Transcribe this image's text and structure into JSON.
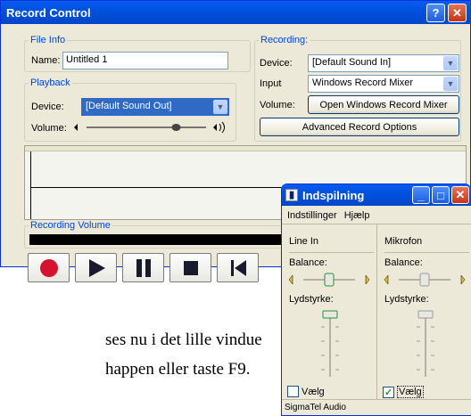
{
  "record_control": {
    "title": "Record Control",
    "file_info": {
      "legend": "File Info",
      "name_label": "Name:",
      "name_value": "Untitled 1"
    },
    "playback": {
      "legend": "Playback",
      "device_label": "Device:",
      "device_value": "[Default Sound Out]",
      "volume_label": "Volume:",
      "volume_level": 0.75
    },
    "recording": {
      "legend": "Recording:",
      "device_label": "Device:",
      "device_value": "[Default Sound In]",
      "input_label": "Input",
      "input_value": "Windows Record Mixer",
      "volume_label": "Volume:",
      "open_mixer_label": "Open Windows Record Mixer",
      "advanced_label": "Advanced Record Options"
    },
    "recording_volume_label": "Recording Volume",
    "transport": [
      "record",
      "play",
      "pause",
      "stop",
      "previous"
    ]
  },
  "mixer": {
    "title": "Indspilning",
    "menu": [
      "Indstillinger",
      "Hjælp"
    ],
    "channels": [
      {
        "name": "Line In",
        "balance_label": "Balance:",
        "volume_label": "Lydstyrke:",
        "select_label": "Vælg",
        "selected": false,
        "balance": 0.5,
        "volume": 0.85
      },
      {
        "name": "Mikrofon",
        "balance_label": "Balance:",
        "volume_label": "Lydstyrke:",
        "select_label": "Vælg",
        "selected": true,
        "balance": 0.5,
        "volume": 0.85
      }
    ],
    "status": "SigmaTel Audio"
  },
  "document": {
    "line1": "ses nu i det lille vindue",
    "line2": "happen eller taste F9."
  }
}
